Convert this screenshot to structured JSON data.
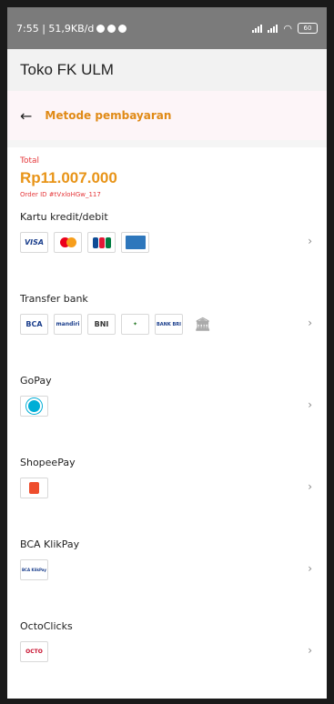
{
  "status_bar": {
    "left_text": "7:55 | 51,9KB/d",
    "battery": "60"
  },
  "app": {
    "title": "Toko FK ULM"
  },
  "header": {
    "back_icon": "back-arrow-icon",
    "title": "Metode pembayaran"
  },
  "summary": {
    "total_label": "Total",
    "total_amount": "Rp11.007.000",
    "order_id": "Order ID #tVxloHGw_117"
  },
  "methods": [
    {
      "label": "Kartu kredit/debit",
      "logos": [
        {
          "text": "VISA"
        },
        {
          "text": ""
        },
        {
          "text": ""
        },
        {
          "text": ""
        }
      ]
    },
    {
      "label": "Transfer bank",
      "logos": [
        {
          "text": "BCA"
        },
        {
          "text": "mandiri"
        },
        {
          "text": "BNI"
        },
        {
          "text": ""
        },
        {
          "text": "BANK BRI"
        },
        {
          "text": ""
        }
      ]
    },
    {
      "label": "GoPay"
    },
    {
      "label": "ShopeePay"
    },
    {
      "label": "BCA KlikPay",
      "logos": [
        {
          "text": "BCA KlikPay"
        }
      ]
    },
    {
      "label": "OctoClicks",
      "logos": [
        {
          "text": "OCTO"
        }
      ]
    }
  ],
  "colors": {
    "accent_orange": "#e89418",
    "accent_red": "#e5383b",
    "header_bg": "#fdf5f8"
  }
}
